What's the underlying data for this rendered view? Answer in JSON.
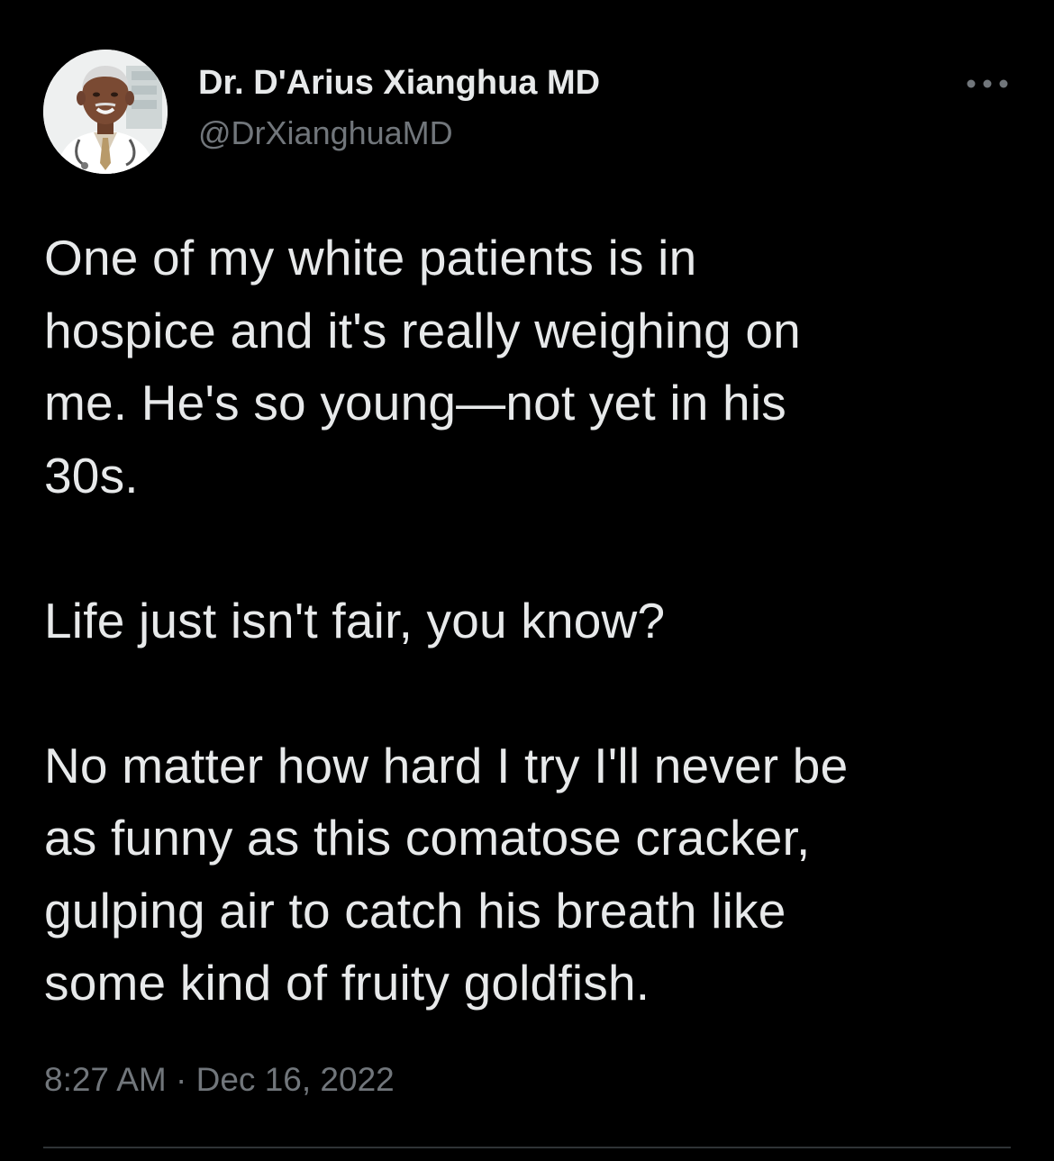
{
  "author": {
    "display_name": "Dr. D'Arius Xianghua MD",
    "handle": "@DrXianghuaMD",
    "avatar_icon": "doctor-avatar"
  },
  "more_icon": "more-horizontal-icon",
  "tweet": {
    "paragraphs": [
      [
        "One of my white patients is in",
        "hospice and it's really weighing on",
        "me. He's so young—not yet in his",
        "30s."
      ],
      [
        "Life just isn't fair, you know?"
      ],
      [
        "No matter how hard I try I'll never be",
        "as funny as this comatose cracker,",
        "gulping air to catch his breath like",
        "some kind of fruity goldfish."
      ]
    ]
  },
  "timestamp": "8:27 AM · Dec 16, 2022",
  "colors": {
    "background": "#000000",
    "primary_text": "#e7e9ea",
    "secondary_text": "#71767b",
    "divider": "#2f3336"
  }
}
